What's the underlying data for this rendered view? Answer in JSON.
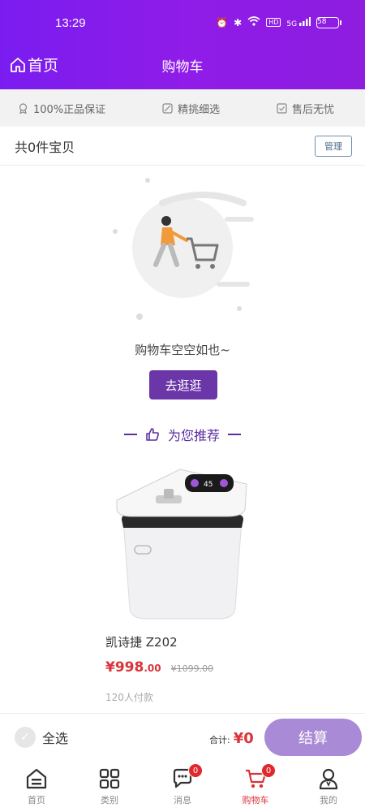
{
  "statusbar": {
    "time": "13:29",
    "battery": "58",
    "network": "5G",
    "hd": "HD"
  },
  "header": {
    "home_label": "首页",
    "title": "购物车"
  },
  "guarantees": [
    {
      "icon": "badge-icon",
      "label": "100%正品保证"
    },
    {
      "icon": "scissors-icon",
      "label": "精挑细选"
    },
    {
      "icon": "check-square-icon",
      "label": "售后无忧"
    }
  ],
  "cart": {
    "count_text": "共0件宝贝",
    "manage_label": "管理"
  },
  "empty": {
    "message": "购物车空空如也~",
    "go_label": "去逛逛"
  },
  "recommend": {
    "title": "为您推荐"
  },
  "product": {
    "name": "凯诗捷 Z202",
    "price_currency": "¥",
    "price_int": "998",
    "price_dec": ".00",
    "original_price": "¥1099.00",
    "buyers": "120人付款"
  },
  "checkout": {
    "select_all_label": "全选",
    "total_label": "合计:",
    "total_value": "¥0",
    "button_label": "结算"
  },
  "tabs": [
    {
      "label": "首页",
      "icon": "home-icon",
      "badge": null
    },
    {
      "label": "类别",
      "icon": "grid-icon",
      "badge": null
    },
    {
      "label": "消息",
      "icon": "chat-icon",
      "badge": "0"
    },
    {
      "label": "购物车",
      "icon": "cart-icon",
      "badge": "0",
      "active": true
    },
    {
      "label": "我的",
      "icon": "user-icon",
      "badge": null
    }
  ],
  "colors": {
    "header_start": "#7a1cf0",
    "accent_purple": "#6a36a8",
    "price_red": "#d9343a",
    "checkout_button": "#a98ad6"
  }
}
